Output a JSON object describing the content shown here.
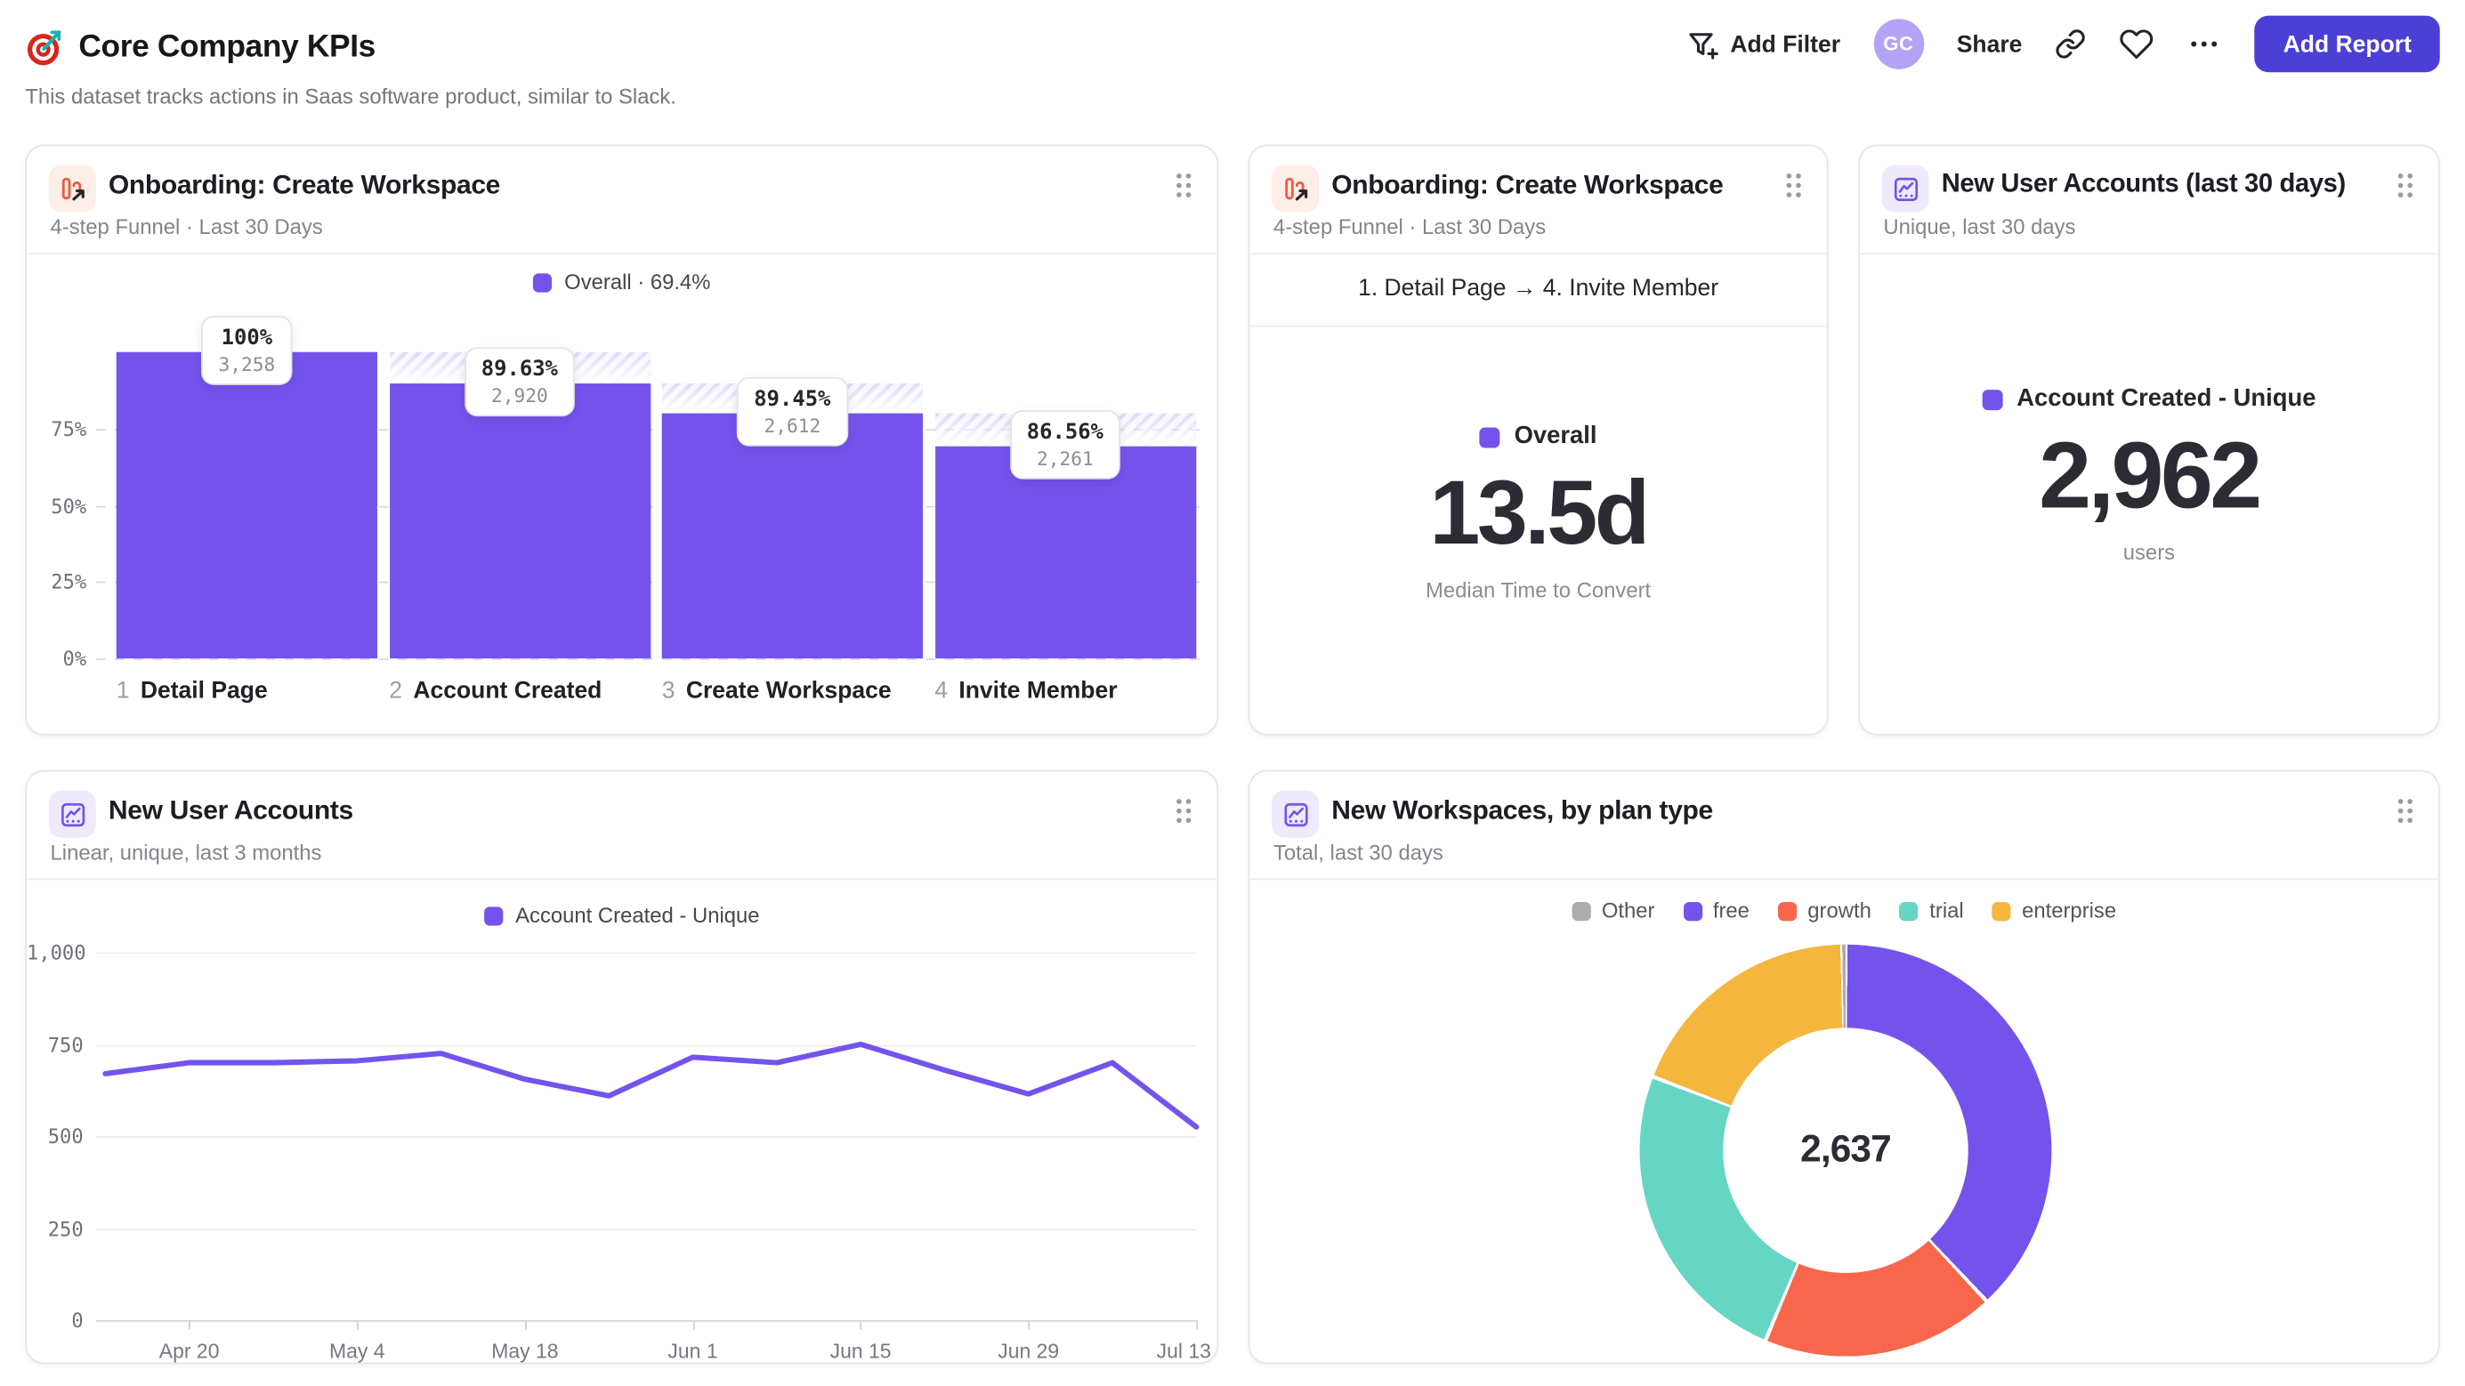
{
  "header": {
    "title": "Core Company KPIs",
    "subtitle": "This dataset tracks actions in Saas software product, similar to Slack.",
    "add_filter_label": "Add Filter",
    "avatar_initials": "GC",
    "share_label": "Share",
    "add_report_label": "Add Report",
    "accent_color": "#4b3fd6"
  },
  "cards": {
    "funnel": {
      "icon": "funnel-chart",
      "title": "Onboarding: Create Workspace",
      "subtitle": "4-step Funnel · Last 30 Days",
      "legend_label": "Overall · 69.4%",
      "chart_data": {
        "type": "bar",
        "variant": "funnel",
        "color": "#7453ec",
        "title": "Onboarding: Create Workspace",
        "y_ticks": [
          "75%",
          "50%",
          "25%",
          "0%"
        ],
        "y_tick_values": [
          75,
          50,
          25,
          0
        ],
        "ylim": [
          0,
          100
        ],
        "overall_conversion": "69.4%",
        "steps": [
          {
            "index": "1",
            "label": "Detail Page",
            "count": 3258,
            "count_label": "3,258",
            "pct_label": "100%"
          },
          {
            "index": "2",
            "label": "Account Created",
            "count": 2920,
            "count_label": "2,920",
            "pct_label": "89.63%"
          },
          {
            "index": "3",
            "label": "Create Workspace",
            "count": 2612,
            "count_label": "2,612",
            "pct_label": "89.45%"
          },
          {
            "index": "4",
            "label": "Invite Member",
            "count": 2261,
            "count_label": "2,261",
            "pct_label": "86.56%"
          }
        ]
      }
    },
    "time": {
      "icon": "funnel-chart",
      "title": "Onboarding: Create Workspace",
      "subtitle": "4-step Funnel · Last 30 Days",
      "step_range": "1. Detail Page → 4. Invite Member",
      "legend_label": "Overall",
      "legend_color": "#7453ec",
      "value": "13.5d",
      "caption": "Median Time to Convert"
    },
    "metric": {
      "icon": "line-chart",
      "title": "New User Accounts (last 30 days)",
      "subtitle": "Unique, last 30 days",
      "legend_label": "Account Created - Unique",
      "legend_color": "#7453ec",
      "value": "2,962",
      "caption": "users"
    },
    "line": {
      "icon": "line-chart",
      "title": "New User Accounts",
      "subtitle": "Linear, unique, last 3 months",
      "legend_label": "Account Created - Unique",
      "chart_data": {
        "type": "line",
        "color": "#7453ec",
        "series": [
          {
            "name": "Account Created - Unique",
            "values": [
              670,
              700,
              700,
              705,
              725,
              655,
              610,
              715,
              700,
              750,
              680,
              615,
              700,
              525
            ]
          }
        ],
        "x_axis_labels": [
          "Apr 20",
          "May 4",
          "May 18",
          "Jun 1",
          "Jun 15",
          "Jun 29",
          "Jul 13"
        ],
        "label_indexes": [
          1,
          3,
          5,
          7,
          9,
          11,
          13
        ],
        "y_ticks": [
          "0",
          "250",
          "500",
          "750",
          "1,000"
        ],
        "y_tick_values": [
          0,
          250,
          500,
          750,
          1000
        ],
        "ylim": [
          0,
          1000
        ],
        "grid": "horizontal"
      }
    },
    "donut": {
      "icon": "line-chart",
      "title": "New Workspaces, by plan type",
      "subtitle": "Total, last 30 days",
      "total_label": "2,637",
      "chart_data": {
        "type": "pie",
        "donut": true,
        "total": 2637,
        "legend_position": "top",
        "segments": [
          {
            "label": "Other",
            "value": 7,
            "color": "#ababb2"
          },
          {
            "label": "free",
            "value": 1003,
            "color": "#7453ec"
          },
          {
            "label": "growth",
            "value": 483,
            "color": "#f8674c"
          },
          {
            "label": "trial",
            "value": 645,
            "color": "#65d6c3"
          },
          {
            "label": "enterprise",
            "value": 499,
            "color": "#f4b63c"
          }
        ]
      }
    }
  }
}
